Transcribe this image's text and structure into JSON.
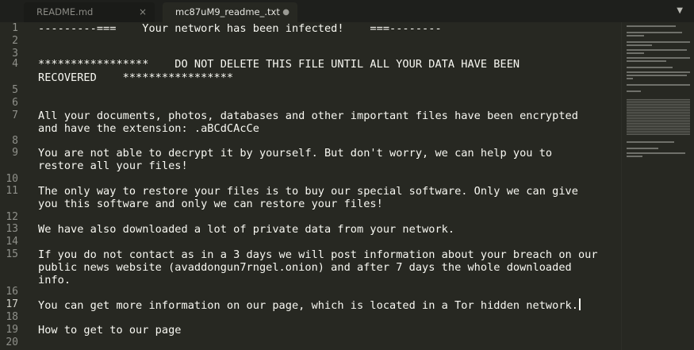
{
  "tabs": [
    {
      "label": "README.md",
      "active": false,
      "control": "×"
    },
    {
      "label": "mc87uM9_readme_.txt",
      "active": true,
      "control": "●"
    }
  ],
  "tab_menu_icon": "chevron-down",
  "current_line": 17,
  "lines": [
    {
      "number": "1",
      "text": "---------===    Your network has been infected!    ===--------"
    },
    {
      "number": "2",
      "text": ""
    },
    {
      "number": "3",
      "text": ""
    },
    {
      "number": "4",
      "text": "*****************    DO NOT DELETE THIS FILE UNTIL ALL YOUR DATA HAVE BEEN",
      "wrap": "RECOVERED    *****************"
    },
    {
      "number": "5",
      "text": ""
    },
    {
      "number": "6",
      "text": ""
    },
    {
      "number": "7",
      "text": "All your documents, photos, databases and other important files have been encrypted",
      "wrap": "and have the extension: .aBCdCAcCe"
    },
    {
      "number": "8",
      "text": ""
    },
    {
      "number": "9",
      "text": "You are not able to decrypt it by yourself. But don't worry, we can help you to",
      "wrap": "restore all your files!"
    },
    {
      "number": "10",
      "text": ""
    },
    {
      "number": "11",
      "text": "The only way to restore your files is to buy our special software. Only we can give",
      "wrap": "you this software and only we can restore your files!"
    },
    {
      "number": "12",
      "text": ""
    },
    {
      "number": "13",
      "text": "We have also downloaded a lot of private data from your network."
    },
    {
      "number": "14",
      "text": ""
    },
    {
      "number": "15",
      "text": "If you do not contact as in a 3 days we will post information about your breach on our",
      "wrap": "public news website (avaddongun7rngel.onion) and after 7 days the whole downloaded",
      "wrap2": "info."
    },
    {
      "number": "16",
      "text": ""
    },
    {
      "number": "17",
      "text": "You can get more information on our page, which is located in a Tor hidden network."
    },
    {
      "number": "18",
      "text": ""
    },
    {
      "number": "19",
      "text": "How to get to our page"
    },
    {
      "number": "20",
      "text": ""
    }
  ]
}
